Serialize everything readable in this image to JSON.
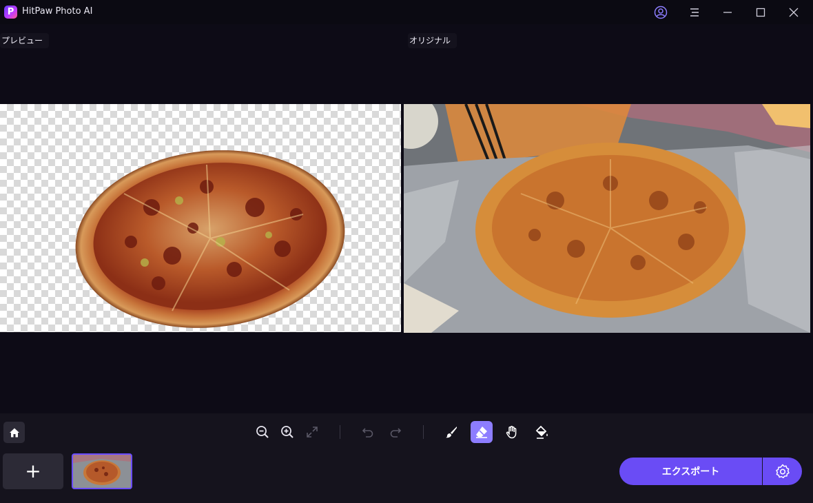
{
  "window": {
    "title": "HitPaw Photo AI",
    "logo_letter": "P",
    "controls": [
      "account-icon",
      "menu-icon",
      "minimize-icon",
      "maximize-icon",
      "close-icon"
    ]
  },
  "canvas": {
    "preview_label": "プレビュー",
    "original_label": "オリジナル"
  },
  "toolbar": {
    "tools": [
      "zoom-out-icon",
      "zoom-in-icon",
      "fit-screen-icon",
      "undo-icon",
      "redo-icon",
      "brush-icon",
      "eraser-icon",
      "hand-icon",
      "fill-icon"
    ],
    "active_tool": "eraser-icon"
  },
  "bottom": {
    "add_label": "+",
    "export_label": "エクスポート"
  },
  "colors": {
    "accent": "#6a4cf5",
    "background": "#0d0b16",
    "panel": "#15131d"
  }
}
